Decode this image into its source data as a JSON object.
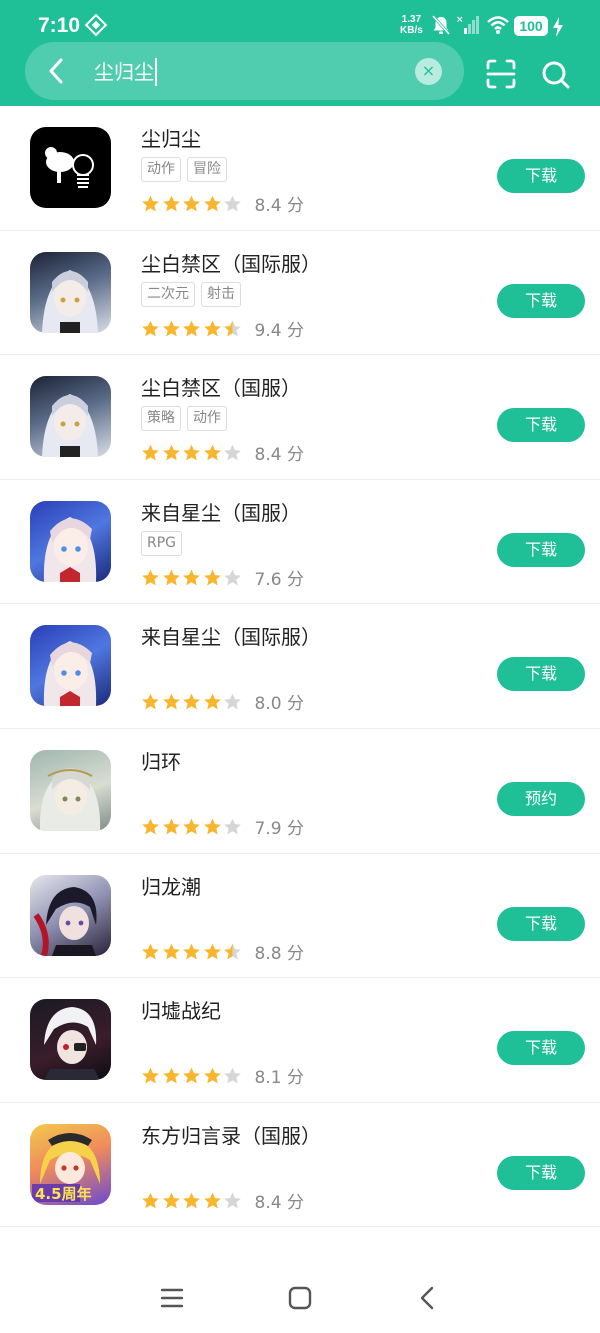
{
  "status_bar": {
    "time": "7:10",
    "net_speed_value": "1.37",
    "net_speed_unit": "KB/s",
    "battery": "100"
  },
  "search": {
    "query": "尘归尘"
  },
  "icons": {
    "back": "arrow-left-icon",
    "clear": "close-circle-icon",
    "scan": "scan-icon",
    "search": "search-icon",
    "menu": "menu-icon",
    "home": "home-icon",
    "nav_back": "nav-back-icon"
  },
  "colors": {
    "accent": "#1fbf98",
    "star": "#f7b62d",
    "star_empty": "#d6d6d6"
  },
  "results": [
    {
      "name": "尘归尘",
      "tags": [
        "动作",
        "冒险"
      ],
      "stars": 4,
      "score": "8.4",
      "score_unit": "分",
      "action": "下载"
    },
    {
      "name": "尘白禁区（国际服）",
      "tags": [
        "二次元",
        "射击"
      ],
      "stars": 4.5,
      "score": "9.4",
      "score_unit": "分",
      "action": "下载"
    },
    {
      "name": "尘白禁区（国服）",
      "tags": [
        "策略",
        "动作"
      ],
      "stars": 4,
      "score": "8.4",
      "score_unit": "分",
      "action": "下载"
    },
    {
      "name": "来自星尘（国服）",
      "tags": [
        "RPG"
      ],
      "stars": 4,
      "score": "7.6",
      "score_unit": "分",
      "action": "下载"
    },
    {
      "name": "来自星尘（国际服）",
      "tags": [],
      "stars": 4,
      "score": "8.0",
      "score_unit": "分",
      "action": "下载"
    },
    {
      "name": "归环",
      "tags": [],
      "stars": 4,
      "score": "7.9",
      "score_unit": "分",
      "action": "预约"
    },
    {
      "name": "归龙潮",
      "tags": [],
      "stars": 4.5,
      "score": "8.8",
      "score_unit": "分",
      "action": "下载"
    },
    {
      "name": "归墟战纪",
      "tags": [],
      "stars": 4,
      "score": "8.1",
      "score_unit": "分",
      "action": "下载"
    },
    {
      "name": "东方归言录（国服）",
      "tags": [],
      "stars": 4,
      "score": "8.4",
      "score_unit": "分",
      "action": "下载",
      "icon_badge": "4.5周年"
    }
  ]
}
